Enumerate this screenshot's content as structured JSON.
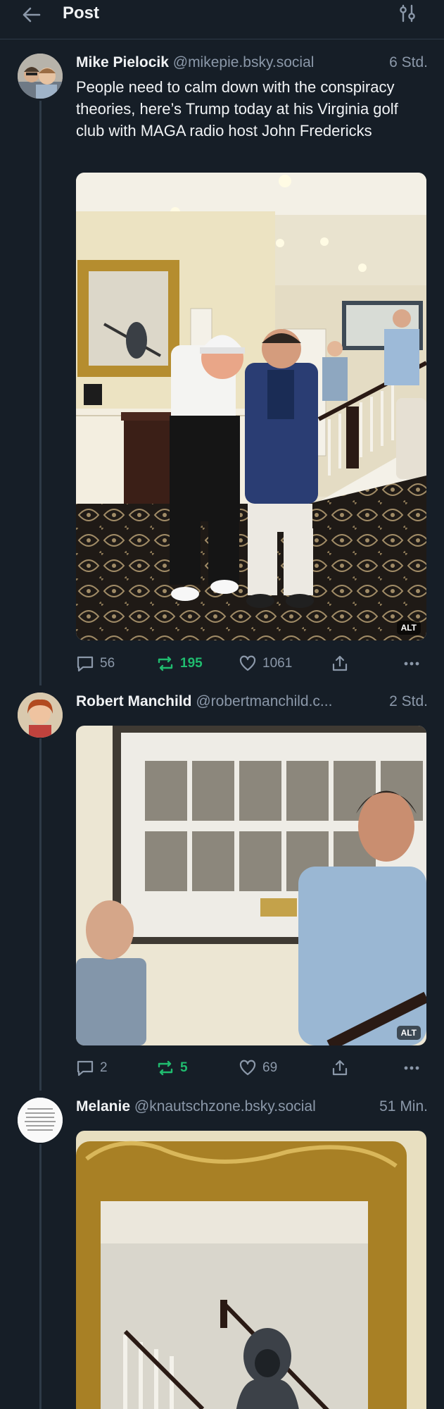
{
  "header": {
    "title": "Post",
    "back_icon": "arrow-left-icon",
    "filter_icon": "sliders-icon"
  },
  "posts": [
    {
      "display_name": "Mike Pielocik",
      "handle": "@mikepie.bsky.social",
      "time": "6 Std.",
      "text": "People need to calm down with the conspiracy theories, here’s Trump today at his Virginia golf club with MAGA radio host John Fredericks",
      "image_alt_badge": "ALT",
      "replies": "56",
      "reposts": "195",
      "likes": "1061"
    },
    {
      "display_name": "Robert Manchild",
      "handle": "@robertmanchild.c...",
      "time": "2 Std.",
      "text": "",
      "image_alt_badge": "ALT",
      "replies": "2",
      "reposts": "5",
      "likes": "69"
    },
    {
      "display_name": "Melanie",
      "handle": "@knautschzone.bsky.social",
      "time": "51 Min.",
      "text": ""
    }
  ],
  "colors": {
    "background": "#161e27",
    "repost_active": "#20bc6f",
    "muted": "#8b98a9"
  }
}
